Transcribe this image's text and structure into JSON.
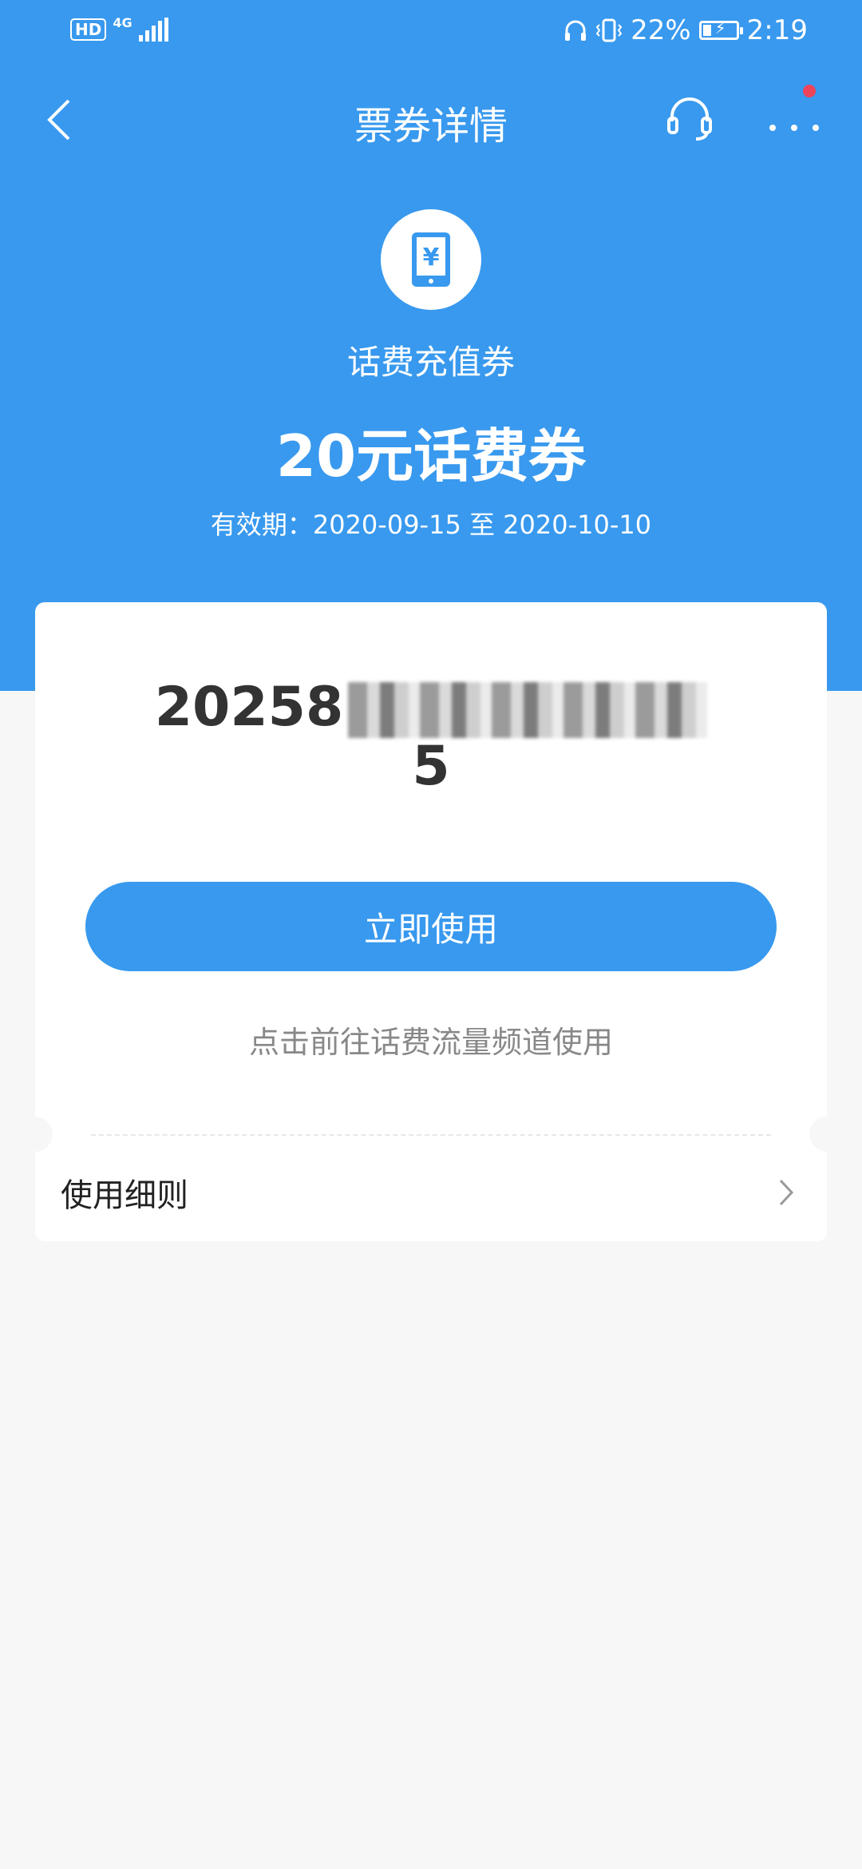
{
  "status_bar": {
    "hd": "HD",
    "network": "4G",
    "battery": "22%",
    "time": "2:19"
  },
  "nav": {
    "title": "票券详情"
  },
  "coupon": {
    "type": "话费充值券",
    "name": "20元话费券",
    "validity": "有效期：2020-09-15 至 2020-10-10",
    "code_visible_start": "20258",
    "code_visible_end": "5"
  },
  "actions": {
    "use_button": "立即使用",
    "hint": "点击前往话费流量频道使用"
  },
  "rules": {
    "label": "使用细则"
  },
  "colors": {
    "primary": "#3899ee",
    "background": "#f7f7f7",
    "badge": "#ee4459"
  }
}
